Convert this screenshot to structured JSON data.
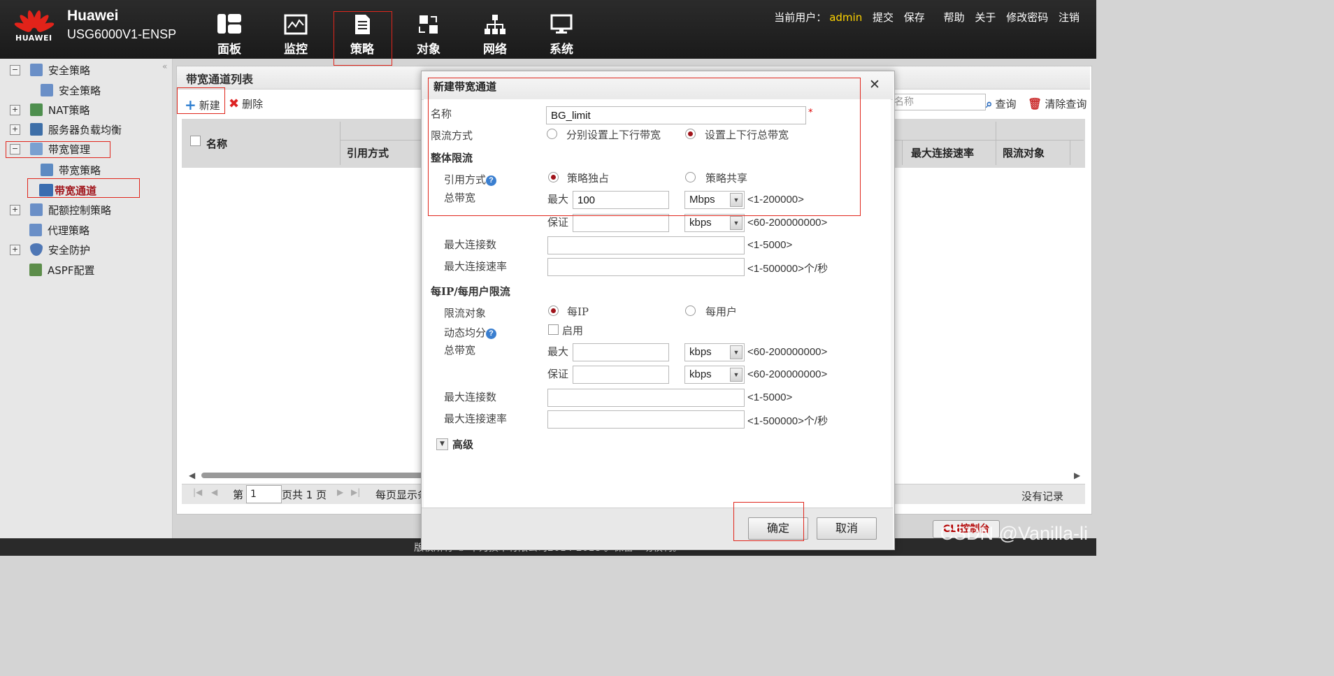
{
  "header": {
    "logo_text": "HUAWEI",
    "brand": "Huawei",
    "model": "USG6000V1-ENSP",
    "nav": [
      {
        "label": "面板",
        "icon": "dashboard-icon"
      },
      {
        "label": "监控",
        "icon": "monitor-icon"
      },
      {
        "label": "策略",
        "icon": "policy-document-icon"
      },
      {
        "label": "对象",
        "icon": "object-icon"
      },
      {
        "label": "网络",
        "icon": "network-icon"
      },
      {
        "label": "系统",
        "icon": "system-computer-icon"
      }
    ],
    "current_user_label": "当前用户：",
    "current_user": "admin",
    "links": {
      "submit": "提交",
      "save": "保存",
      "help": "帮助",
      "about": "关于",
      "change_password": "修改密码",
      "logout": "注销"
    }
  },
  "sidebar": {
    "items": [
      {
        "label": "安全策略",
        "toggle": "−"
      },
      {
        "label": "安全策略"
      },
      {
        "label": "NAT策略",
        "toggle": "+"
      },
      {
        "label": "服务器负载均衡",
        "toggle": "+"
      },
      {
        "label": "带宽管理",
        "toggle": "−"
      },
      {
        "label": "带宽策略"
      },
      {
        "label": "带宽通道"
      },
      {
        "label": "配额控制策略",
        "toggle": "+"
      },
      {
        "label": "代理策略"
      },
      {
        "label": "安全防护",
        "toggle": "+"
      },
      {
        "label": "ASPF配置"
      }
    ]
  },
  "main": {
    "title": "带宽通道列表",
    "toolbar": {
      "new": "新建",
      "delete": "删除",
      "search_placeholder": "名称",
      "query": "查询",
      "clear_query": "清除查询"
    },
    "columns": {
      "name": "名称",
      "reference_mode": "引用方式",
      "max_conn_rate": "最大连接速率",
      "limit_object": "限流对象"
    },
    "pager": {
      "page_prefix": "第",
      "page": "1",
      "total": "页共 1 页",
      "per_page": "每页显示条",
      "no_records": "没有记录"
    },
    "cli_button": "CLI控制台"
  },
  "dialog": {
    "title": "新建带宽通道",
    "name_label": "名称",
    "name_value": "BG_limit",
    "limit_mode_label": "限流方式",
    "limit_mode_options": [
      "分别设置上下行带宽",
      "设置上下行总带宽"
    ],
    "overall_section": "整体限流",
    "ref_mode_label": "引用方式",
    "ref_mode_options": [
      "策略独占",
      "策略共享"
    ],
    "total_bw_label": "总带宽",
    "max_label": "最大",
    "guarantee_label": "保证",
    "overall_max_value": "100",
    "overall_max_unit": "Mbps",
    "overall_max_range": "<1-200000>",
    "overall_guar_unit": "kbps",
    "overall_guar_range": "<60-200000000>",
    "max_conn_label": "最大连接数",
    "max_conn_range": "<1-5000>",
    "max_conn_rate_label": "最大连接速率",
    "max_conn_rate_range": "<1-500000>个/秒",
    "per_section": "每IP/每用户限流",
    "limit_object_label": "限流对象",
    "limit_object_options": [
      "每IP",
      "每用户"
    ],
    "dynamic_share_label": "动态均分",
    "enable_label": "启用",
    "per_max_unit": "kbps",
    "per_max_range": "<60-200000000>",
    "per_guar_unit": "kbps",
    "per_guar_range": "<60-200000000>",
    "advanced_label": "高级",
    "ok": "确定",
    "cancel": "取消"
  },
  "footer": {
    "copyright": "版权所有 © 华为技术有限公司2014-2018 。保留一切权利。"
  },
  "watermark": "CSDN @Vanilla-li",
  "colors": {
    "accent_red": "#e0261c",
    "radio_selected": "#a0141b",
    "username": "#ffd400"
  }
}
